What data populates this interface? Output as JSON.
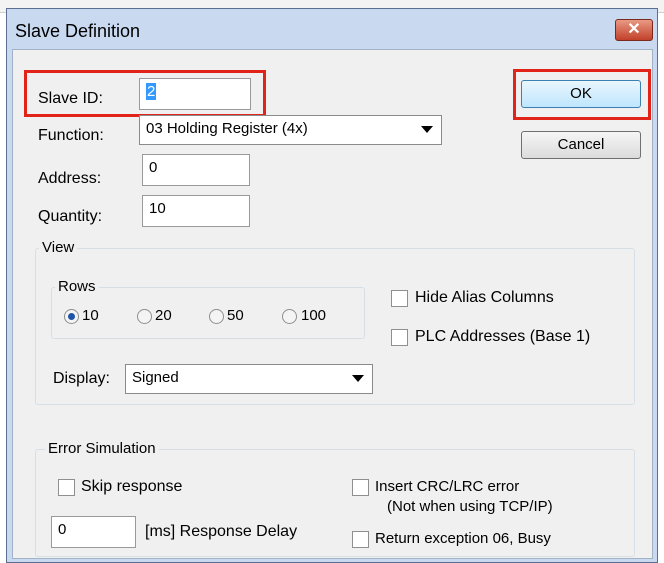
{
  "window": {
    "title": "Slave Definition"
  },
  "form": {
    "slave_id_label": "Slave ID:",
    "slave_id_value": "2",
    "function_label": "Function:",
    "function_value": "03 Holding Register (4x)",
    "address_label": "Address:",
    "address_value": "0",
    "quantity_label": "Quantity:",
    "quantity_value": "10"
  },
  "buttons": {
    "ok": "OK",
    "cancel": "Cancel"
  },
  "view": {
    "title": "View",
    "rows_title": "Rows",
    "rows_options": [
      "10",
      "20",
      "50",
      "100"
    ],
    "rows_selected": "10",
    "hide_alias_label": "Hide Alias Columns",
    "plc_addresses_label": "PLC Addresses (Base 1)",
    "display_label": "Display:",
    "display_value": "Signed"
  },
  "error_sim": {
    "title": "Error Simulation",
    "skip_response_label": "Skip response",
    "insert_crc_label": "Insert CRC/LRC error",
    "insert_crc_note": "(Not when using TCP/IP)",
    "delay_value": "0",
    "delay_label": "[ms] Response Delay",
    "return_exception_label": "Return exception 06, Busy"
  },
  "colors": {
    "highlight": "#e2231a",
    "selection": "#3399ff"
  },
  "icons": {
    "close": "close-icon",
    "dropdown": "chevron-down-icon"
  }
}
